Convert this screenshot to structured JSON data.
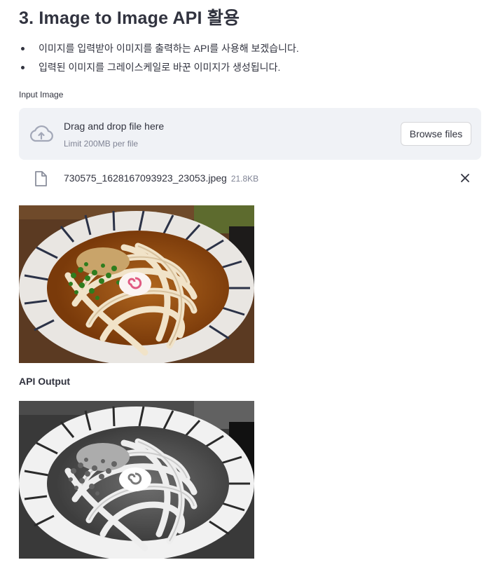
{
  "page": {
    "title": "3. Image to Image API 활용",
    "bullets": [
      "이미지를 입력받아 이미지를 출력하는 API를 사용해 보겠습니다.",
      "입력된 이미지를 그레이스케일로 바꾼 이미지가 생성됩니다."
    ]
  },
  "uploader": {
    "label": "Input Image",
    "drop_text": "Drag and drop file here",
    "limit_text": "Limit 200MB per file",
    "browse_label": "Browse files",
    "icon": "cloud-upload-icon"
  },
  "file": {
    "name": "730575_1628167093923_23053.jpeg",
    "size": "21.8KB",
    "icon": "file-icon",
    "remove_icon": "close-icon"
  },
  "input_image": {
    "description_icon": "udon-bowl-photo"
  },
  "output": {
    "label": "API Output"
  },
  "colors": {
    "text": "#31333f",
    "muted": "#808495",
    "dropzone_bg": "#f0f2f6",
    "border": "#d6d6d9"
  }
}
